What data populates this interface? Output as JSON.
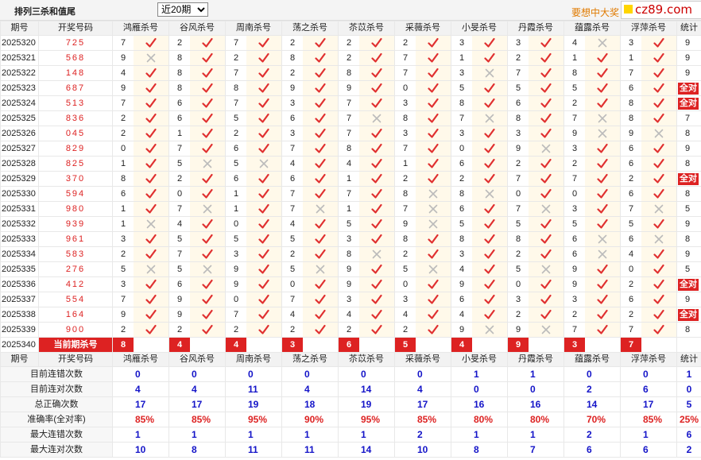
{
  "page": {
    "title": "排列三杀和值尾",
    "period_select": "近20期",
    "promo_text": "要想中大奖",
    "logo_text": "cz89.com"
  },
  "headers": [
    "期号",
    "开奖号码",
    "鸿雁杀号",
    "谷风杀号",
    "周南杀号",
    "荡之杀号",
    "苶苡杀号",
    "采薇杀号",
    "小旻杀号",
    "丹霞杀号",
    "蕴露杀号",
    "浮萍杀号",
    "统计"
  ],
  "rows": [
    {
      "period": "2025320",
      "draw": "725",
      "kills": [
        [
          7,
          "y"
        ],
        [
          2,
          "y"
        ],
        [
          7,
          "y"
        ],
        [
          2,
          "y"
        ],
        [
          2,
          "y"
        ],
        [
          2,
          "y"
        ],
        [
          3,
          "y"
        ],
        [
          3,
          "y"
        ],
        [
          4,
          "n"
        ],
        [
          3,
          "y"
        ]
      ],
      "stat": "9"
    },
    {
      "period": "2025321",
      "draw": "568",
      "kills": [
        [
          9,
          "n"
        ],
        [
          8,
          "y"
        ],
        [
          2,
          "y"
        ],
        [
          8,
          "y"
        ],
        [
          2,
          "y"
        ],
        [
          7,
          "y"
        ],
        [
          1,
          "y"
        ],
        [
          2,
          "y"
        ],
        [
          1,
          "y"
        ],
        [
          1,
          "y"
        ]
      ],
      "stat": "9"
    },
    {
      "period": "2025322",
      "draw": "148",
      "kills": [
        [
          4,
          "y"
        ],
        [
          8,
          "y"
        ],
        [
          7,
          "y"
        ],
        [
          2,
          "y"
        ],
        [
          8,
          "y"
        ],
        [
          7,
          "y"
        ],
        [
          3,
          "n"
        ],
        [
          7,
          "y"
        ],
        [
          8,
          "y"
        ],
        [
          7,
          "y"
        ]
      ],
      "stat": "9"
    },
    {
      "period": "2025323",
      "draw": "687",
      "kills": [
        [
          9,
          "y"
        ],
        [
          8,
          "y"
        ],
        [
          8,
          "y"
        ],
        [
          9,
          "y"
        ],
        [
          9,
          "y"
        ],
        [
          0,
          "y"
        ],
        [
          5,
          "y"
        ],
        [
          5,
          "y"
        ],
        [
          5,
          "y"
        ],
        [
          6,
          "y"
        ]
      ],
      "stat": "全对"
    },
    {
      "period": "2025324",
      "draw": "513",
      "kills": [
        [
          7,
          "y"
        ],
        [
          6,
          "y"
        ],
        [
          7,
          "y"
        ],
        [
          3,
          "y"
        ],
        [
          7,
          "y"
        ],
        [
          3,
          "y"
        ],
        [
          8,
          "y"
        ],
        [
          6,
          "y"
        ],
        [
          2,
          "y"
        ],
        [
          8,
          "y"
        ]
      ],
      "stat": "全对"
    },
    {
      "period": "2025325",
      "draw": "836",
      "kills": [
        [
          2,
          "y"
        ],
        [
          6,
          "y"
        ],
        [
          5,
          "y"
        ],
        [
          6,
          "y"
        ],
        [
          7,
          "n"
        ],
        [
          8,
          "y"
        ],
        [
          7,
          "n"
        ],
        [
          8,
          "y"
        ],
        [
          7,
          "n"
        ],
        [
          8,
          "y"
        ]
      ],
      "stat": "7"
    },
    {
      "period": "2025326",
      "draw": "045",
      "kills": [
        [
          2,
          "y"
        ],
        [
          1,
          "y"
        ],
        [
          2,
          "y"
        ],
        [
          3,
          "y"
        ],
        [
          7,
          "y"
        ],
        [
          3,
          "y"
        ],
        [
          3,
          "y"
        ],
        [
          3,
          "y"
        ],
        [
          9,
          "n"
        ],
        [
          9,
          "n"
        ]
      ],
      "stat": "8"
    },
    {
      "period": "2025327",
      "draw": "829",
      "kills": [
        [
          0,
          "y"
        ],
        [
          7,
          "y"
        ],
        [
          6,
          "y"
        ],
        [
          7,
          "y"
        ],
        [
          8,
          "y"
        ],
        [
          7,
          "y"
        ],
        [
          0,
          "y"
        ],
        [
          9,
          "n"
        ],
        [
          3,
          "y"
        ],
        [
          6,
          "y"
        ]
      ],
      "stat": "9"
    },
    {
      "period": "2025328",
      "draw": "825",
      "kills": [
        [
          1,
          "y"
        ],
        [
          5,
          "n"
        ],
        [
          5,
          "n"
        ],
        [
          4,
          "y"
        ],
        [
          4,
          "y"
        ],
        [
          1,
          "y"
        ],
        [
          6,
          "y"
        ],
        [
          2,
          "y"
        ],
        [
          2,
          "y"
        ],
        [
          6,
          "y"
        ]
      ],
      "stat": "8"
    },
    {
      "period": "2025329",
      "draw": "370",
      "kills": [
        [
          8,
          "y"
        ],
        [
          2,
          "y"
        ],
        [
          6,
          "y"
        ],
        [
          6,
          "y"
        ],
        [
          1,
          "y"
        ],
        [
          2,
          "y"
        ],
        [
          2,
          "y"
        ],
        [
          7,
          "y"
        ],
        [
          7,
          "y"
        ],
        [
          2,
          "y"
        ]
      ],
      "stat": "全对"
    },
    {
      "period": "2025330",
      "draw": "594",
      "kills": [
        [
          6,
          "y"
        ],
        [
          0,
          "y"
        ],
        [
          1,
          "y"
        ],
        [
          7,
          "y"
        ],
        [
          7,
          "y"
        ],
        [
          8,
          "n"
        ],
        [
          8,
          "n"
        ],
        [
          0,
          "y"
        ],
        [
          0,
          "y"
        ],
        [
          6,
          "y"
        ]
      ],
      "stat": "8"
    },
    {
      "period": "2025331",
      "draw": "980",
      "kills": [
        [
          1,
          "y"
        ],
        [
          7,
          "n"
        ],
        [
          1,
          "y"
        ],
        [
          7,
          "n"
        ],
        [
          1,
          "y"
        ],
        [
          7,
          "n"
        ],
        [
          6,
          "y"
        ],
        [
          7,
          "n"
        ],
        [
          3,
          "y"
        ],
        [
          7,
          "n"
        ]
      ],
      "stat": "5"
    },
    {
      "period": "2025332",
      "draw": "939",
      "kills": [
        [
          1,
          "n"
        ],
        [
          4,
          "y"
        ],
        [
          0,
          "y"
        ],
        [
          4,
          "y"
        ],
        [
          5,
          "y"
        ],
        [
          9,
          "n"
        ],
        [
          5,
          "y"
        ],
        [
          5,
          "y"
        ],
        [
          5,
          "y"
        ],
        [
          5,
          "y"
        ]
      ],
      "stat": "9"
    },
    {
      "period": "2025333",
      "draw": "961",
      "kills": [
        [
          3,
          "y"
        ],
        [
          5,
          "y"
        ],
        [
          5,
          "y"
        ],
        [
          5,
          "y"
        ],
        [
          3,
          "y"
        ],
        [
          8,
          "y"
        ],
        [
          8,
          "y"
        ],
        [
          8,
          "y"
        ],
        [
          6,
          "n"
        ],
        [
          6,
          "n"
        ]
      ],
      "stat": "8"
    },
    {
      "period": "2025334",
      "draw": "583",
      "kills": [
        [
          2,
          "y"
        ],
        [
          7,
          "y"
        ],
        [
          3,
          "y"
        ],
        [
          2,
          "y"
        ],
        [
          8,
          "n"
        ],
        [
          2,
          "y"
        ],
        [
          3,
          "y"
        ],
        [
          2,
          "y"
        ],
        [
          6,
          "n"
        ],
        [
          4,
          "y"
        ]
      ],
      "stat": "9"
    },
    {
      "period": "2025335",
      "draw": "276",
      "kills": [
        [
          5,
          "n"
        ],
        [
          5,
          "n"
        ],
        [
          9,
          "y"
        ],
        [
          5,
          "n"
        ],
        [
          9,
          "y"
        ],
        [
          5,
          "n"
        ],
        [
          4,
          "y"
        ],
        [
          5,
          "n"
        ],
        [
          9,
          "y"
        ],
        [
          0,
          "y"
        ]
      ],
      "stat": "5"
    },
    {
      "period": "2025336",
      "draw": "412",
      "kills": [
        [
          3,
          "y"
        ],
        [
          6,
          "y"
        ],
        [
          9,
          "y"
        ],
        [
          0,
          "y"
        ],
        [
          9,
          "y"
        ],
        [
          0,
          "y"
        ],
        [
          9,
          "y"
        ],
        [
          0,
          "y"
        ],
        [
          9,
          "y"
        ],
        [
          2,
          "y"
        ]
      ],
      "stat": "全对"
    },
    {
      "period": "2025337",
      "draw": "554",
      "kills": [
        [
          7,
          "y"
        ],
        [
          9,
          "y"
        ],
        [
          0,
          "y"
        ],
        [
          7,
          "y"
        ],
        [
          3,
          "y"
        ],
        [
          3,
          "y"
        ],
        [
          6,
          "y"
        ],
        [
          3,
          "y"
        ],
        [
          3,
          "y"
        ],
        [
          6,
          "y"
        ]
      ],
      "stat": "9"
    },
    {
      "period": "2025338",
      "draw": "164",
      "kills": [
        [
          9,
          "y"
        ],
        [
          9,
          "y"
        ],
        [
          7,
          "y"
        ],
        [
          4,
          "y"
        ],
        [
          4,
          "y"
        ],
        [
          4,
          "y"
        ],
        [
          4,
          "y"
        ],
        [
          2,
          "y"
        ],
        [
          2,
          "y"
        ],
        [
          2,
          "y"
        ]
      ],
      "stat": "全对"
    },
    {
      "period": "2025339",
      "draw": "900",
      "kills": [
        [
          2,
          "y"
        ],
        [
          2,
          "y"
        ],
        [
          2,
          "y"
        ],
        [
          2,
          "y"
        ],
        [
          2,
          "y"
        ],
        [
          2,
          "y"
        ],
        [
          9,
          "n"
        ],
        [
          9,
          "n"
        ],
        [
          7,
          "y"
        ],
        [
          7,
          "y"
        ]
      ],
      "stat": "8"
    }
  ],
  "current": {
    "period": "2025340",
    "label": "当前期杀号",
    "kills": [
      "8",
      "4",
      "4",
      "3",
      "6",
      "5",
      "4",
      "9",
      "3",
      "7"
    ]
  },
  "summary": {
    "headers": [
      "期号",
      "开奖号码",
      "鸿雁杀号",
      "谷风杀号",
      "周南杀号",
      "荡之杀号",
      "苶苡杀号",
      "采薇杀号",
      "小旻杀号",
      "丹霞杀号",
      "蕴露杀号",
      "浮萍杀号",
      "统计"
    ],
    "rows": [
      {
        "label": "目前连错次数",
        "values": [
          "0",
          "0",
          "0",
          "0",
          "0",
          "0",
          "1",
          "1",
          "0",
          "0",
          "1"
        ],
        "pct": false
      },
      {
        "label": "目前连对次数",
        "values": [
          "4",
          "4",
          "11",
          "4",
          "14",
          "4",
          "0",
          "0",
          "2",
          "6",
          "0"
        ],
        "pct": false
      },
      {
        "label": "总正确次数",
        "values": [
          "17",
          "17",
          "19",
          "18",
          "19",
          "17",
          "16",
          "16",
          "14",
          "17",
          "5"
        ],
        "pct": false
      },
      {
        "label": "准确率(全对率)",
        "values": [
          "85%",
          "85%",
          "95%",
          "90%",
          "95%",
          "85%",
          "80%",
          "80%",
          "70%",
          "85%",
          "25%"
        ],
        "pct": true
      },
      {
        "label": "最大连错次数",
        "values": [
          "1",
          "1",
          "1",
          "1",
          "1",
          "2",
          "1",
          "1",
          "2",
          "1",
          "6"
        ],
        "pct": false
      },
      {
        "label": "最大连对次数",
        "values": [
          "10",
          "8",
          "11",
          "11",
          "14",
          "10",
          "8",
          "7",
          "6",
          "6",
          "2"
        ],
        "pct": false
      }
    ]
  },
  "colors": {
    "accent_red": "#dd2222",
    "check_red": "#e03030",
    "cross_grey": "#bbbbbb",
    "value_blue": "#1414c8"
  },
  "icons": {
    "correct": "check-icon",
    "wrong": "cross-icon"
  }
}
